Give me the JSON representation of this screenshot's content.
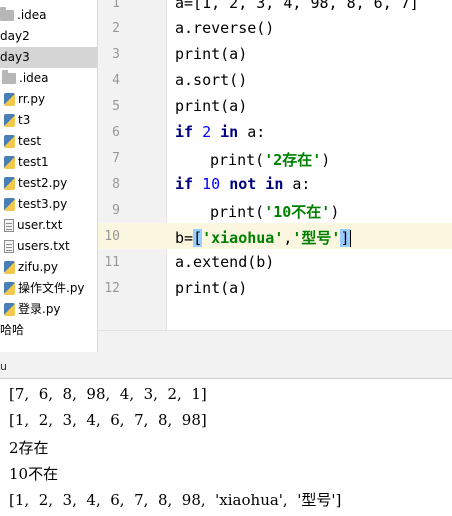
{
  "sidebar": {
    "items": [
      {
        "label": ".idea",
        "icon": "folder-icon"
      },
      {
        "label": "day2",
        "icon": "none"
      },
      {
        "label": "day3",
        "icon": "none",
        "selected": true
      },
      {
        "label": ".idea",
        "icon": "folder-icon"
      },
      {
        "label": "rr.py",
        "icon": "python-file-icon"
      },
      {
        "label": "t3",
        "icon": "python-file-icon"
      },
      {
        "label": "test",
        "icon": "python-file-icon"
      },
      {
        "label": "test1",
        "icon": "python-file-icon"
      },
      {
        "label": "test2.py",
        "icon": "python-file-icon"
      },
      {
        "label": "test3.py",
        "icon": "python-file-icon"
      },
      {
        "label": "user.txt",
        "icon": "text-file-icon"
      },
      {
        "label": "users.txt",
        "icon": "text-file-icon"
      },
      {
        "label": "zifu.py",
        "icon": "python-file-icon"
      },
      {
        "label": "操作文件.py",
        "icon": "python-file-icon"
      },
      {
        "label": "登录.py",
        "icon": "python-file-icon"
      },
      {
        "label": "哈哈",
        "icon": "none"
      }
    ]
  },
  "editor": {
    "line_numbers": [
      "1",
      "2",
      "3",
      "4",
      "5",
      "6",
      "7",
      "8",
      "9",
      "10",
      "11",
      "12"
    ],
    "current_line": "10",
    "lines": {
      "l1": "a=[1, 2, 3, 4, 98, 8, 6, 7]",
      "l2": "a.reverse()",
      "l3": "print(a)",
      "l4": "a.sort()",
      "l5": "print(a)",
      "l6_kw1": "if",
      "l6_num": "2",
      "l6_kw2": "in",
      "l6_rest": "a:",
      "l7_fn": "print(",
      "l7_str": "'2存在'",
      "l7_end": ")",
      "l8_kw1": "if",
      "l8_num": "10",
      "l8_kw2": "not in",
      "l8_rest": "a:",
      "l9_fn": "print(",
      "l9_str": "'10不在'",
      "l9_end": ")",
      "l10_pre": "b=",
      "l10_open": "[",
      "l10_str1": "'xiaohua'",
      "l10_comma": ",",
      "l10_str2": "'型号'",
      "l10_close": "]",
      "l11": "a.extend(b)",
      "l12": "print(a)"
    }
  },
  "run_panel": {
    "tab_fragment": "u"
  },
  "console": {
    "output": [
      "[7,  6,  8,  98,  4,  3,  2,  1]",
      "[1,  2,  3,  4,  6,  7,  8,  98]",
      "2存在",
      "10不在",
      "[1,  2,  3,  4,  6,  7,  8,  98,  'xiaohua',  '型号']"
    ]
  },
  "colors": {
    "keyword": "#000080",
    "number": "#0000ff",
    "string": "#008000",
    "current_line_bg": "#fbf6df",
    "bracket_highlight": "#99ccff"
  }
}
